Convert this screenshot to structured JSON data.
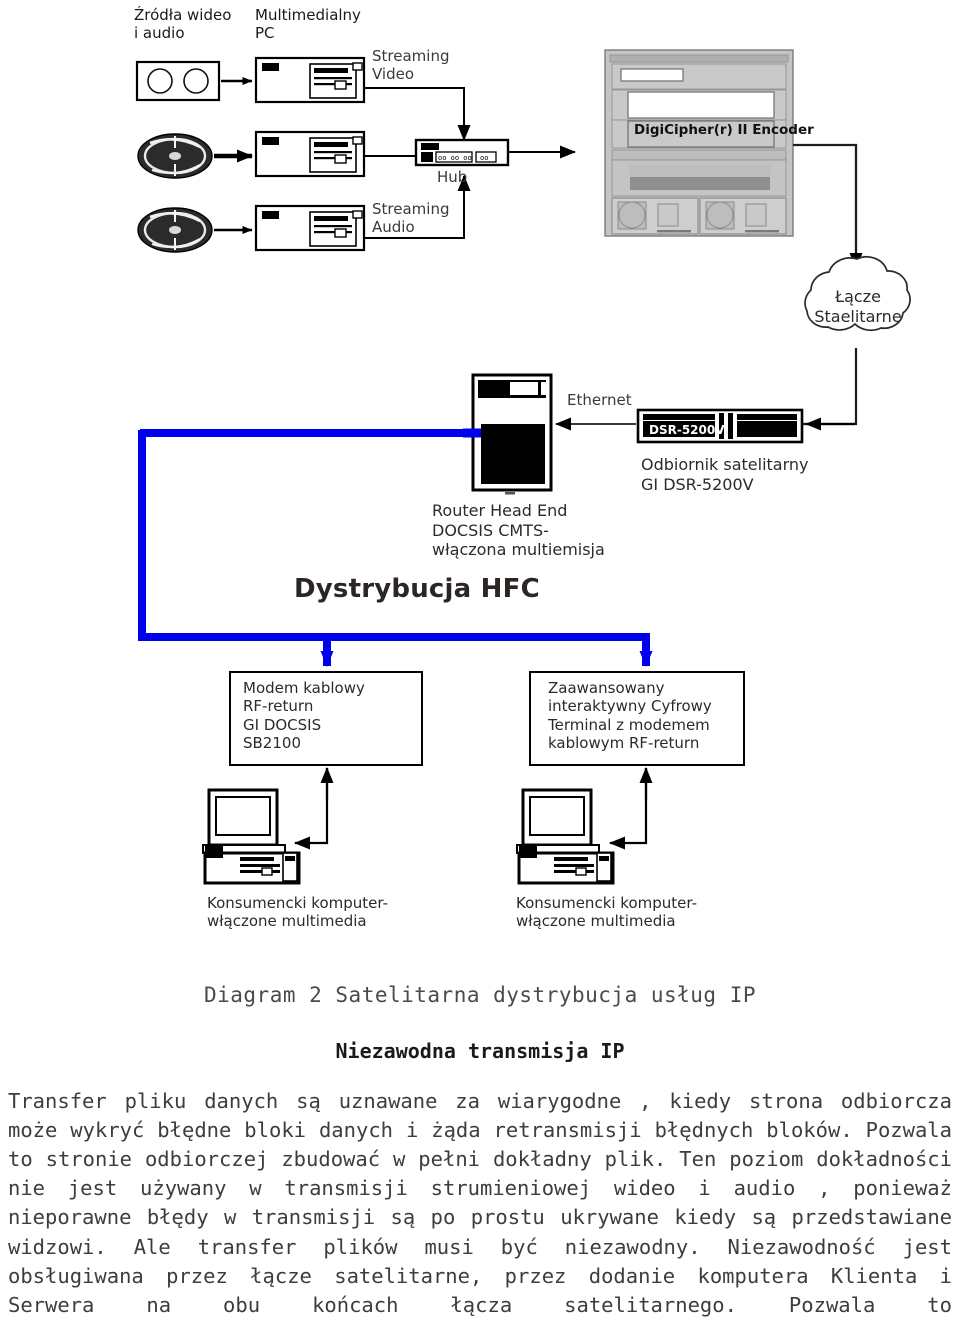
{
  "document": {
    "caption": "Diagram 2 Satelitarna dystrybucja usług IP",
    "subheading": "Niezawodna transmisja IP",
    "body_paragraph": "Transfer pliku danych są uznawane za wiarygodne , kiedy strona odbiorcza może wykryć błędne bloki danych i żąda retransmisji błędnych bloków. Pozwala to stronie odbiorczej zbudować w pełni dokładny plik. Ten poziom dokładności nie jest używany w transmisji strumieniowej wideo i audio , ponieważ nieporawne błędy w transmisji są po prostu ukrywane kiedy są przedstawiane widzowi. Ale transfer plików musi być niezawodny. Niezawodność jest obsługiwana przez łącze satelitarne, przez dodanie komputera Klienta i Serwera na obu końcach łącza satelitarnego. Pozwala to"
  },
  "diagram": {
    "labels": {
      "sources": "Źródła wideo\ni audio",
      "multimedia_pc": "Multimedialny\nPC",
      "streaming_video": "Streaming\nVideo",
      "streaming_audio": "Streaming\nAudio",
      "hub": "Hub",
      "encoder": "DigiCipher(r) II Encoder",
      "satellite_cloud": "Łącze\nStaelitarne",
      "ethernet": "Ethernet",
      "dsr_device": "DSR-5200V",
      "satellite_receiver": "Odbiornik satelitarny\nGI DSR-5200V",
      "router_head_end": "Router Head End\nDOCSIS CMTS-\nwłączona multiemisja",
      "hfc_distribution": "Dystrybucja HFC",
      "cable_modem": "Modem kablowy\nRF-return\nGI DOCSIS\nSB2100",
      "advanced_terminal": "Zaawansowany\ninteraktywny Cyfrowy\nTerminal z modemem\nkablowym RF-return",
      "consumer_pc_left": "Konsumencki komputer-\nwłączone multimedia",
      "consumer_pc_right": "Konsumencki komputer-\nwłączone multimedia"
    },
    "colors": {
      "hfc_line": "#0000ee",
      "line": "#000000",
      "encoder_body": "#b9b9b9",
      "encoder_dark": "#8a8a8a",
      "text": "#1a1a1a"
    }
  }
}
